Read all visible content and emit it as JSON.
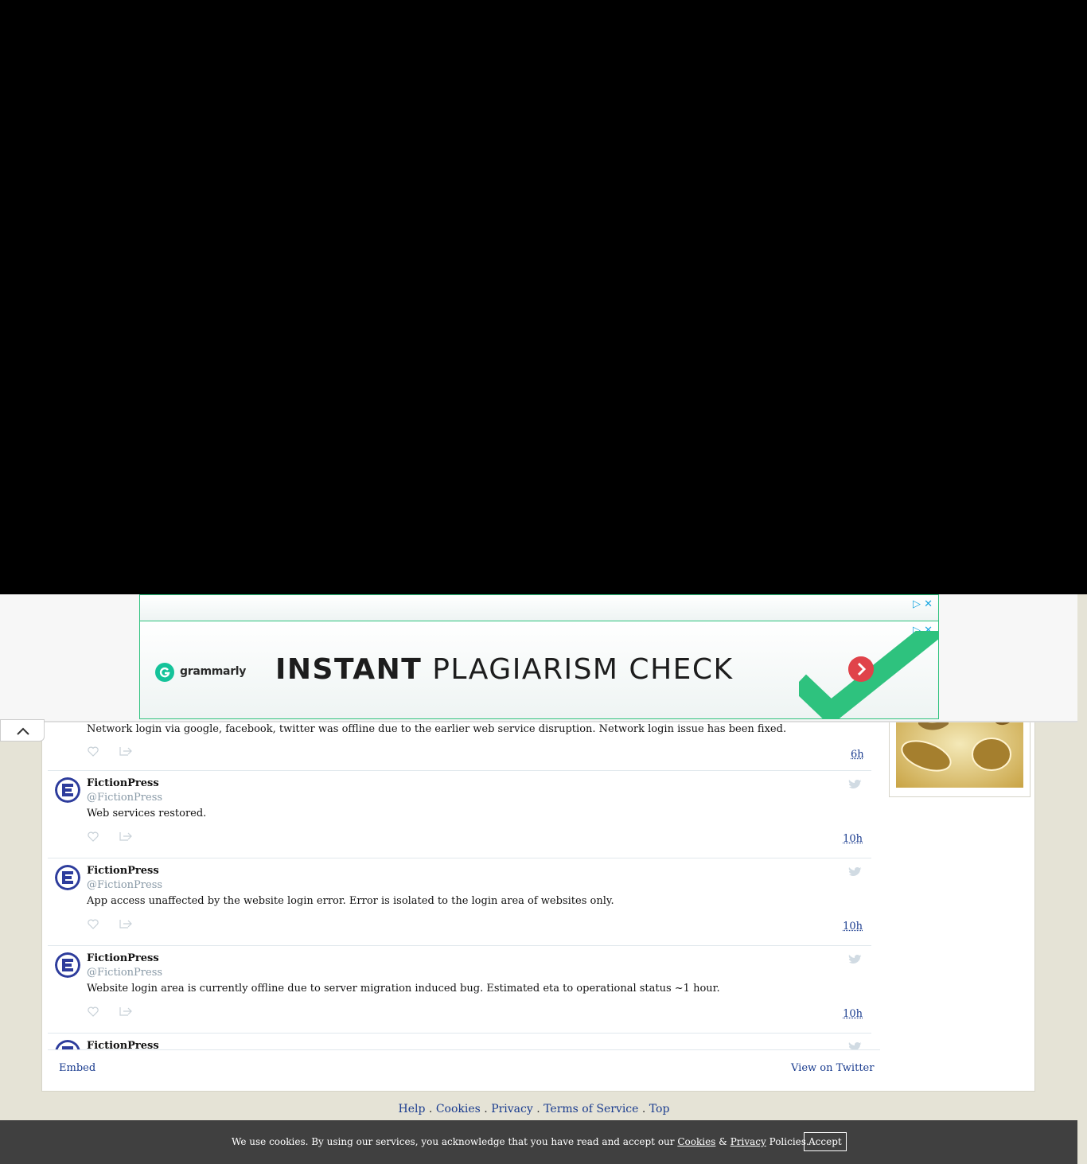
{
  "ad": {
    "brand": "grammarly",
    "headline_bold": "INSTANT",
    "headline_rest": "PLAGIARISM CHECK",
    "colors": {
      "border": "#2ec27e",
      "arrow": "#e0434a",
      "brand": "#15c39a"
    }
  },
  "timeline": {
    "first_tweet": {
      "text": "Network login via google, facebook, twitter was offline due to the earlier web service disruption. Network login issue has been fixed.",
      "time": "6h"
    },
    "tweets": [
      {
        "author": "FictionPress",
        "handle": "@FictionPress",
        "text": "Web services restored.",
        "time": "10h"
      },
      {
        "author": "FictionPress",
        "handle": "@FictionPress",
        "text": "App access unaffected by the website login error. Error is isolated to the login area of websites only.",
        "time": "10h"
      },
      {
        "author": "FictionPress",
        "handle": "@FictionPress",
        "text": "Website login area is currently offline due to server migration induced bug. Estimated eta to operational status ~1 hour.",
        "time": "10h"
      },
      {
        "author": "FictionPress"
      }
    ],
    "embed_label": "Embed",
    "view_label": "View on Twitter"
  },
  "footer": {
    "help": "Help",
    "cookies": "Cookies",
    "privacy": "Privacy",
    "terms": "Terms of Service",
    "top": "Top",
    "sep": "."
  },
  "cookie_bar": {
    "text_before": "We use cookies. By using our services, you acknowledge that you have read and accept our",
    "cookies_link": "Cookies",
    "amp": "&",
    "privacy_link": "Privacy",
    "text_after": "Policies.",
    "accept": "Accept"
  }
}
